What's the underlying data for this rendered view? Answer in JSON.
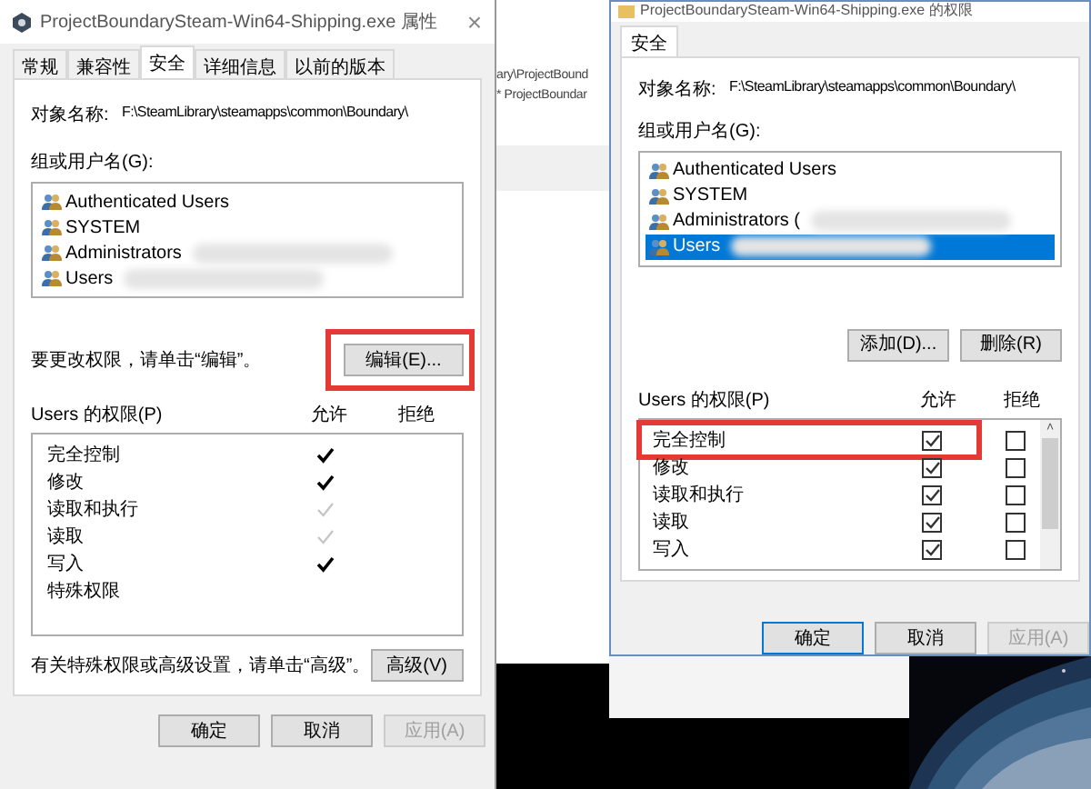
{
  "left_dialog": {
    "title": "ProjectBoundarySteam-Win64-Shipping.exe 属性",
    "tabs": [
      {
        "label": "常规",
        "selected": false
      },
      {
        "label": "兼容性",
        "selected": false
      },
      {
        "label": "安全",
        "selected": true
      },
      {
        "label": "详细信息",
        "selected": false
      },
      {
        "label": "以前的版本",
        "selected": false
      }
    ],
    "object_label": "对象名称:",
    "object_path": "F:\\SteamLibrary\\steamapps\\common\\Boundary\\",
    "groups_label": "组或用户名(G):",
    "groups": [
      {
        "name": "Authenticated Users",
        "selected": false,
        "blurred": false
      },
      {
        "name": "SYSTEM",
        "selected": false,
        "blurred": false
      },
      {
        "name": "Administrators",
        "selected": false,
        "blurred": true
      },
      {
        "name": "Users",
        "selected": false,
        "blurred": true
      }
    ],
    "edit_hint": "要更改权限，请单击“编辑”。",
    "edit_button": "编辑(E)...",
    "edit_highlighted": true,
    "perm_label": "Users 的权限(P)",
    "allow_header": "允许",
    "deny_header": "拒绝",
    "permissions": [
      {
        "label": "完全控制",
        "allow": true,
        "inherited": false
      },
      {
        "label": "修改",
        "allow": true,
        "inherited": false
      },
      {
        "label": "读取和执行",
        "allow": true,
        "inherited": true
      },
      {
        "label": "读取",
        "allow": true,
        "inherited": true
      },
      {
        "label": "写入",
        "allow": true,
        "inherited": false
      },
      {
        "label": "特殊权限",
        "allow": false
      }
    ],
    "advanced_hint": "有关特殊权限或高级设置，请单击“高级”。",
    "advanced_button": "高级(V)",
    "buttons": [
      {
        "label": "确定",
        "disabled": false
      },
      {
        "label": "取消",
        "disabled": false
      },
      {
        "label": "应用(A)",
        "disabled": true
      }
    ]
  },
  "close_glyph": "×",
  "scroll_up_glyph": "˄",
  "background_window": {
    "lines": [
      "ary\\ProjectBound",
      "* ProjectBoundar"
    ]
  },
  "right_dialog": {
    "title": "ProjectBoundarySteam-Win64-Shipping.exe 的权限",
    "tabs": [
      {
        "label": "安全",
        "selected": true
      }
    ],
    "object_label": "对象名称:",
    "object_path": "F:\\SteamLibrary\\steamapps\\common\\Boundary\\",
    "groups_label": "组或用户名(G):",
    "groups": [
      {
        "name": "Authenticated Users",
        "selected": false,
        "blurred": false
      },
      {
        "name": "SYSTEM",
        "selected": false,
        "blurred": false
      },
      {
        "name": "Administrators (",
        "selected": false,
        "blurred": true
      },
      {
        "name": "Users",
        "selected": true,
        "blurred": true
      }
    ],
    "add_button": "添加(D)...",
    "remove_button": "删除(R)",
    "perm_label": "Users 的权限(P)",
    "allow_header": "允许",
    "deny_header": "拒绝",
    "permissions": [
      {
        "label": "完全控制",
        "allow": true,
        "deny": false,
        "highlighted": true
      },
      {
        "label": "修改",
        "allow": true,
        "deny": false,
        "highlighted": false
      },
      {
        "label": "读取和执行",
        "allow": true,
        "deny": false,
        "highlighted": false
      },
      {
        "label": "读取",
        "allow": true,
        "deny": false,
        "highlighted": false
      },
      {
        "label": "写入",
        "allow": true,
        "deny": false,
        "highlighted": false
      }
    ],
    "buttons": [
      {
        "label": "确定",
        "disabled": false,
        "focused": true
      },
      {
        "label": "取消",
        "disabled": false,
        "focused": false
      },
      {
        "label": "应用(A)",
        "disabled": true,
        "focused": false
      }
    ]
  }
}
